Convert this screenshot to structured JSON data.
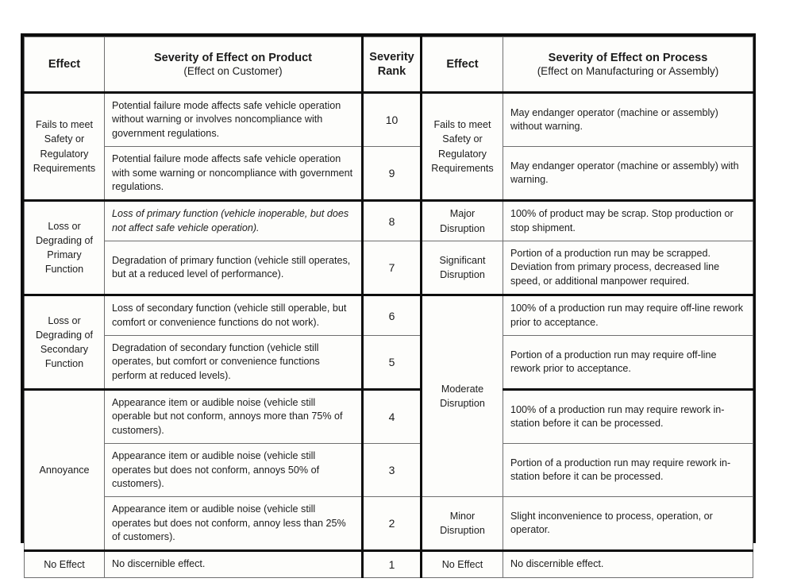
{
  "table": {
    "headers": {
      "effect_product": "Effect",
      "severity_product_main": "Severity of Effect on Product",
      "severity_product_sub": "(Effect on Customer)",
      "severity_rank_line1": "Severity",
      "severity_rank_line2": "Rank",
      "effect_process": "Effect",
      "severity_process_main": "Severity of Effect on Process",
      "severity_process_sub": "(Effect on Manufacturing or Assembly)"
    },
    "product_effect_groups": [
      {
        "label_lines": [
          "Fails to meet",
          "Safety or",
          "Regulatory",
          "Requirements"
        ],
        "rowspan": 2
      },
      {
        "label_lines": [
          "Loss or",
          "Degrading of",
          "Primary",
          "Function"
        ],
        "rowspan": 2
      },
      {
        "label_lines": [
          "Loss or",
          "Degrading of",
          "Secondary",
          "Function"
        ],
        "rowspan": 2
      },
      {
        "label_lines": [
          "Annoyance"
        ],
        "rowspan": 3
      },
      {
        "label_lines": [
          "No Effect"
        ],
        "rowspan": 1
      }
    ],
    "process_effect_groups": [
      {
        "label_lines": [
          "Fails to meet",
          "Safety or",
          "Regulatory",
          "Requirements"
        ],
        "rowspan": 2
      },
      {
        "label_lines": [
          "Major",
          "Disruption"
        ],
        "rowspan": 1
      },
      {
        "label_lines": [
          "Significant",
          "Disruption"
        ],
        "rowspan": 1
      },
      {
        "label_lines": [
          "Moderate",
          "Disruption"
        ],
        "rowspan": 4
      },
      {
        "label_lines": [
          "Minor",
          "Disruption"
        ],
        "rowspan": 1
      },
      {
        "label_lines": [
          "No Effect"
        ],
        "rowspan": 1
      }
    ],
    "rows": [
      {
        "rank": "10",
        "product_effect": "Potential failure mode affects safe vehicle operation without warning or involves noncompliance with government regulations.",
        "process_effect": "May endanger operator (machine or assembly) without warning.",
        "product_italic": false
      },
      {
        "rank": "9",
        "product_effect": "Potential failure mode affects safe vehicle operation with some warning or noncompliance with government regulations.",
        "process_effect": "May endanger operator (machine or assembly) with warning.",
        "product_italic": false
      },
      {
        "rank": "8",
        "product_effect": "Loss of primary function (vehicle inoperable, but does not affect safe vehicle operation).",
        "process_effect": "100% of product may be scrap.  Stop production or stop shipment.",
        "product_italic": true
      },
      {
        "rank": "7",
        "product_effect": "Degradation of primary function (vehicle still operates, but at a reduced level of performance).",
        "process_effect": "Portion of a production run may be scrapped. Deviation from primary process, decreased line speed, or additional manpower required.",
        "product_italic": false
      },
      {
        "rank": "6",
        "product_effect": "Loss of secondary function (vehicle still operable, but comfort or convenience functions do not work).",
        "process_effect": "100% of a production run may require off-line rework prior to acceptance.",
        "product_italic": false
      },
      {
        "rank": "5",
        "product_effect": "Degradation of secondary function (vehicle still operates, but comfort or convenience functions perform at reduced levels).",
        "process_effect": "Portion of a production run may require off-line rework prior to acceptance.",
        "product_italic": false
      },
      {
        "rank": "4",
        "product_effect": "Appearance item or audible noise (vehicle still operable but not conform, annoys more than 75% of customers).",
        "process_effect": "100% of a production run may require rework in-station before it can be processed.",
        "product_italic": false
      },
      {
        "rank": "3",
        "product_effect": "Appearance item or audible noise (vehicle still operates but does not conform, annoys 50% of customers).",
        "process_effect": "Portion of a production run may require rework in-station before it can be processed.",
        "product_italic": false
      },
      {
        "rank": "2",
        "product_effect": "Appearance item or audible noise (vehicle still operates but does not conform, annoy less than 25% of customers).",
        "process_effect": "Slight inconvenience to process, operation, or operator.",
        "product_italic": false
      },
      {
        "rank": "1",
        "product_effect": "No discernible effect.",
        "process_effect": "No discernible effect.",
        "product_italic": false
      }
    ]
  },
  "colors": {
    "frame": "#0d0d0d",
    "grid": "#6f6f6f",
    "background": "#ffffff",
    "cell_background": "#fdfdfb",
    "text": "#1c1c1c"
  }
}
